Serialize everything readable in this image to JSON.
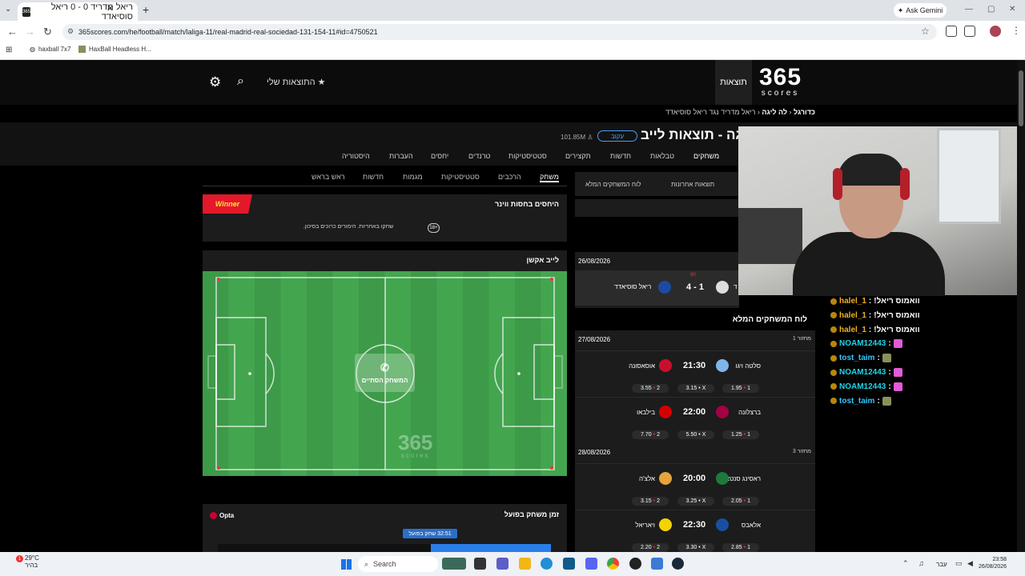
{
  "browser": {
    "tab_title": "ריאל מדריד 0 - 0 ריאל סוסיאדד",
    "tab_icon_text": "365",
    "url": "365scores.com/he/football/match/laliga-11/real-madrid-real-sociedad-131-154-11#id=4750521",
    "gemini_label": "Ask Gemini",
    "bookmarks": [
      "haxball 7x7",
      "HaxBall Headless H..."
    ]
  },
  "site": {
    "logo_number": "365",
    "logo_word": "scores",
    "nav_results": "תוצאות",
    "my_results": "התוצאות שלי",
    "breadcrumb": {
      "part1": "כדורגל",
      "part2": "לה ליגה",
      "part3": "ריאל מדריד נגד ריאל סוסיאדד"
    },
    "competition_title": "ליגה - תוצאות לייב",
    "follow": "עקוב",
    "followers": "101.85M",
    "comp_tabs": [
      "משחקים",
      "טבלאות",
      "חדשות",
      "תקצירים",
      "סטטיסטיקות",
      "טרנדים",
      "יחסים",
      "העברות",
      "היסטוריה"
    ],
    "match_tabs": [
      "משחק",
      "הרכבים",
      "סטטיסטיקות",
      "מגמות",
      "חדשות",
      "ראש בראש"
    ],
    "odds": {
      "brand": "Winner",
      "title": "היחסים בחסות ווינר",
      "age": "18+",
      "disclaimer": "שחקו באחריות. הימורים כרוכים בסיכון."
    },
    "live_action": "לייב אקשן",
    "match_over": "המשחק הסתיים",
    "playtime": {
      "title": "זמן משחק בפועל",
      "provider": "Opta",
      "label": "32:51 שחק בפועל",
      "fraction": 0.36
    },
    "right_tabs": [
      "תוצאות אחרונות",
      "לוח המשחקים המלא"
    ],
    "result": {
      "date": "26/08/2026",
      "home": "ריאל מדריד",
      "away": "ריאל סוסיאדד",
      "score": "4 - 1",
      "minute": "90"
    },
    "full_schedule_title": "לוח המשחקים המלא",
    "days": [
      {
        "date": "27/08/2026",
        "round": "מחזור 1",
        "fixtures": [
          {
            "home": "סלטה ויגו",
            "away": "אוסאסונה",
            "time": "21:30",
            "o1": "1.95",
            "ox": "3.15",
            "o2": "3.55",
            "c1": "#7fb6e8",
            "c2": "#c8102e"
          },
          {
            "home": "ברצלונה",
            "away": "בילבאו",
            "time": "22:00",
            "o1": "1.25",
            "ox": "5.50",
            "o2": "7.70",
            "c1": "#a50044",
            "c2": "#d40000"
          }
        ]
      },
      {
        "date": "28/08/2026",
        "round": "מחזור 3",
        "fixtures": [
          {
            "home": "ראסינג סנטאנדר",
            "away": "אלצ'ה",
            "time": "20:00",
            "o1": "2.05",
            "ox": "3.25",
            "o2": "3.15",
            "c1": "#1e7a3c",
            "c2": "#e8a33c"
          },
          {
            "home": "אלאבס",
            "away": "ויאריאל",
            "time": "22:30",
            "o1": "2.85",
            "ox": "3.30",
            "o2": "2.20",
            "c1": "#1a4fa0",
            "c2": "#f3d400"
          }
        ]
      }
    ]
  },
  "chat": [
    {
      "user": "halel_1",
      "msg": "!וואמוס ריאל",
      "color": "#f0b020",
      "emote": false
    },
    {
      "user": "halel_1",
      "msg": "!וואמוס ריאל",
      "color": "#f0b020",
      "emote": false
    },
    {
      "user": "halel_1",
      "msg": "!וואמוס ריאל",
      "color": "#f0b020",
      "emote": false
    },
    {
      "user": "NOAM12443",
      "msg": "",
      "color": "#21d4e8",
      "emote": "pink"
    },
    {
      "user": "tost_taim",
      "msg": "",
      "color": "#36c6ff",
      "emote": "olive"
    },
    {
      "user": "NOAM12443",
      "msg": "",
      "color": "#21d4e8",
      "emote": "pink"
    },
    {
      "user": "NOAM12443",
      "msg": "",
      "color": "#21d4e8",
      "emote": "pink"
    },
    {
      "user": "tost_taim",
      "msg": "",
      "color": "#36c6ff",
      "emote": "olive"
    }
  ],
  "taskbar": {
    "weather_temp": "29°C",
    "weather_desc": "בהיר",
    "notif": "1",
    "search": "Search",
    "lang": "עבר",
    "time": "23:58",
    "date": "26/08/2026"
  }
}
